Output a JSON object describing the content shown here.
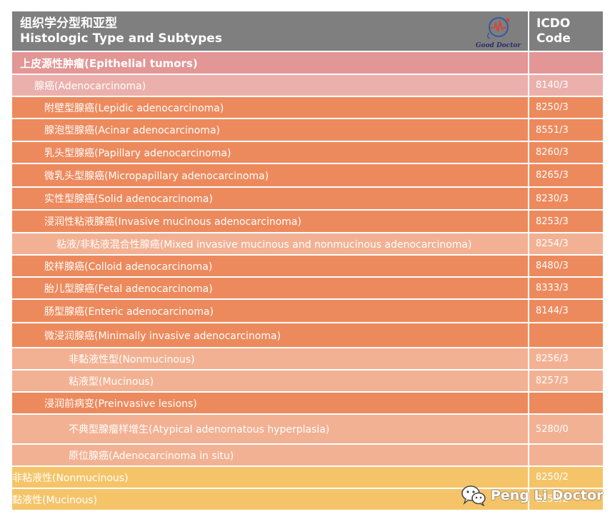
{
  "header": {
    "type_title_zh": "组织学分型和亚型",
    "type_title_en": "Histologic Type and Subtypes",
    "code_title_1": "ICDO",
    "code_title_2": "Code",
    "logo_text": "Good Doctor"
  },
  "colors": {
    "header": "#7f7f7f",
    "pink_dark": "#e29695",
    "pink_light": "#ebb0ac",
    "orange": "#ed8a5d",
    "salmon": "#f3b193",
    "gold": "#f5c469"
  },
  "rows": [
    {
      "label": "上皮源性肿瘤(Epithelial tumors)",
      "code": "",
      "level": 0,
      "color": "#e29695"
    },
    {
      "label": "腺癌(Adenocarcinoma)",
      "code": "8140/3",
      "level": 1,
      "color": "#ebb0ac"
    },
    {
      "label": "附壁型腺癌(Lepidic adenocarcinoma)",
      "code": "8250/3",
      "level": 2,
      "color": "#ed8a5d"
    },
    {
      "label": "腺泡型腺癌(Acinar adenocarcinoma)",
      "code": "8551/3",
      "level": 2,
      "color": "#ed8a5d"
    },
    {
      "label": "乳头型腺癌(Papillary adenocarcinoma)",
      "code": "8260/3",
      "level": 2,
      "color": "#ed8a5d"
    },
    {
      "label": "微乳头型腺癌(Micropapillary adenocarcinoma)",
      "code": "8265/3",
      "level": 2,
      "color": "#ed8a5d"
    },
    {
      "label": "实性型腺癌(Solid adenocarcinoma)",
      "code": "8230/3",
      "level": 2,
      "color": "#ed8a5d"
    },
    {
      "label": "浸润性粘液腺癌(Invasive mucinous adenocarcinoma)",
      "code": "8253/3",
      "level": 2,
      "color": "#ed8a5d"
    },
    {
      "label": "粘液/非粘液混合性腺癌(Mixed invasive mucinous and nonmucinous adenocarcinoma)",
      "code": "8254/3",
      "level": 3,
      "color": "#f3b193"
    },
    {
      "label": "胶样腺癌(Colloid adenocarcinoma)",
      "code": "8480/3",
      "level": 2,
      "color": "#ed8a5d"
    },
    {
      "label": "胎儿型腺癌(Fetal adenocarcinoma)",
      "code": "8333/3",
      "level": 2,
      "color": "#ed8a5d"
    },
    {
      "label": "肠型腺癌(Enteric adenocarcinoma)",
      "code": "8144/3",
      "level": 2,
      "color": "#ed8a5d"
    },
    {
      "label": "微浸润腺癌(Minimally invasive adenocarcinoma)",
      "code": "",
      "level": 2,
      "color": "#ed8a5d"
    },
    {
      "label": "非黏液性型(Nonmucinous)",
      "code": "8256/3",
      "level": 4,
      "color": "#f3b193"
    },
    {
      "label": "粘液型(Mucinous)",
      "code": "8257/3",
      "level": 4,
      "color": "#f3b193"
    },
    {
      "label": "浸润前病变(Preinvasive lesions)",
      "code": "",
      "level": 2,
      "color": "#ed8a5d"
    },
    {
      "label": "不典型腺瘤样增生(Atypical adenomatous hyperplasia)",
      "code": "5280/0",
      "level": 4,
      "color": "#f3b193"
    },
    {
      "label": "原位腺癌(Adenocarcinoma in situ)",
      "code": "",
      "level": 4,
      "color": "#f3b193"
    },
    {
      "label": "非粘液性(Nonmucinous)",
      "code": "8250/2",
      "level": 5,
      "color": "#f5c469"
    },
    {
      "label": "黏液性(Mucinous)",
      "code": "8253/2",
      "level": 5,
      "color": "#f5c469"
    }
  ],
  "watermark": {
    "text": "Peng Li Doctor",
    "icon": "wechat-icon"
  }
}
